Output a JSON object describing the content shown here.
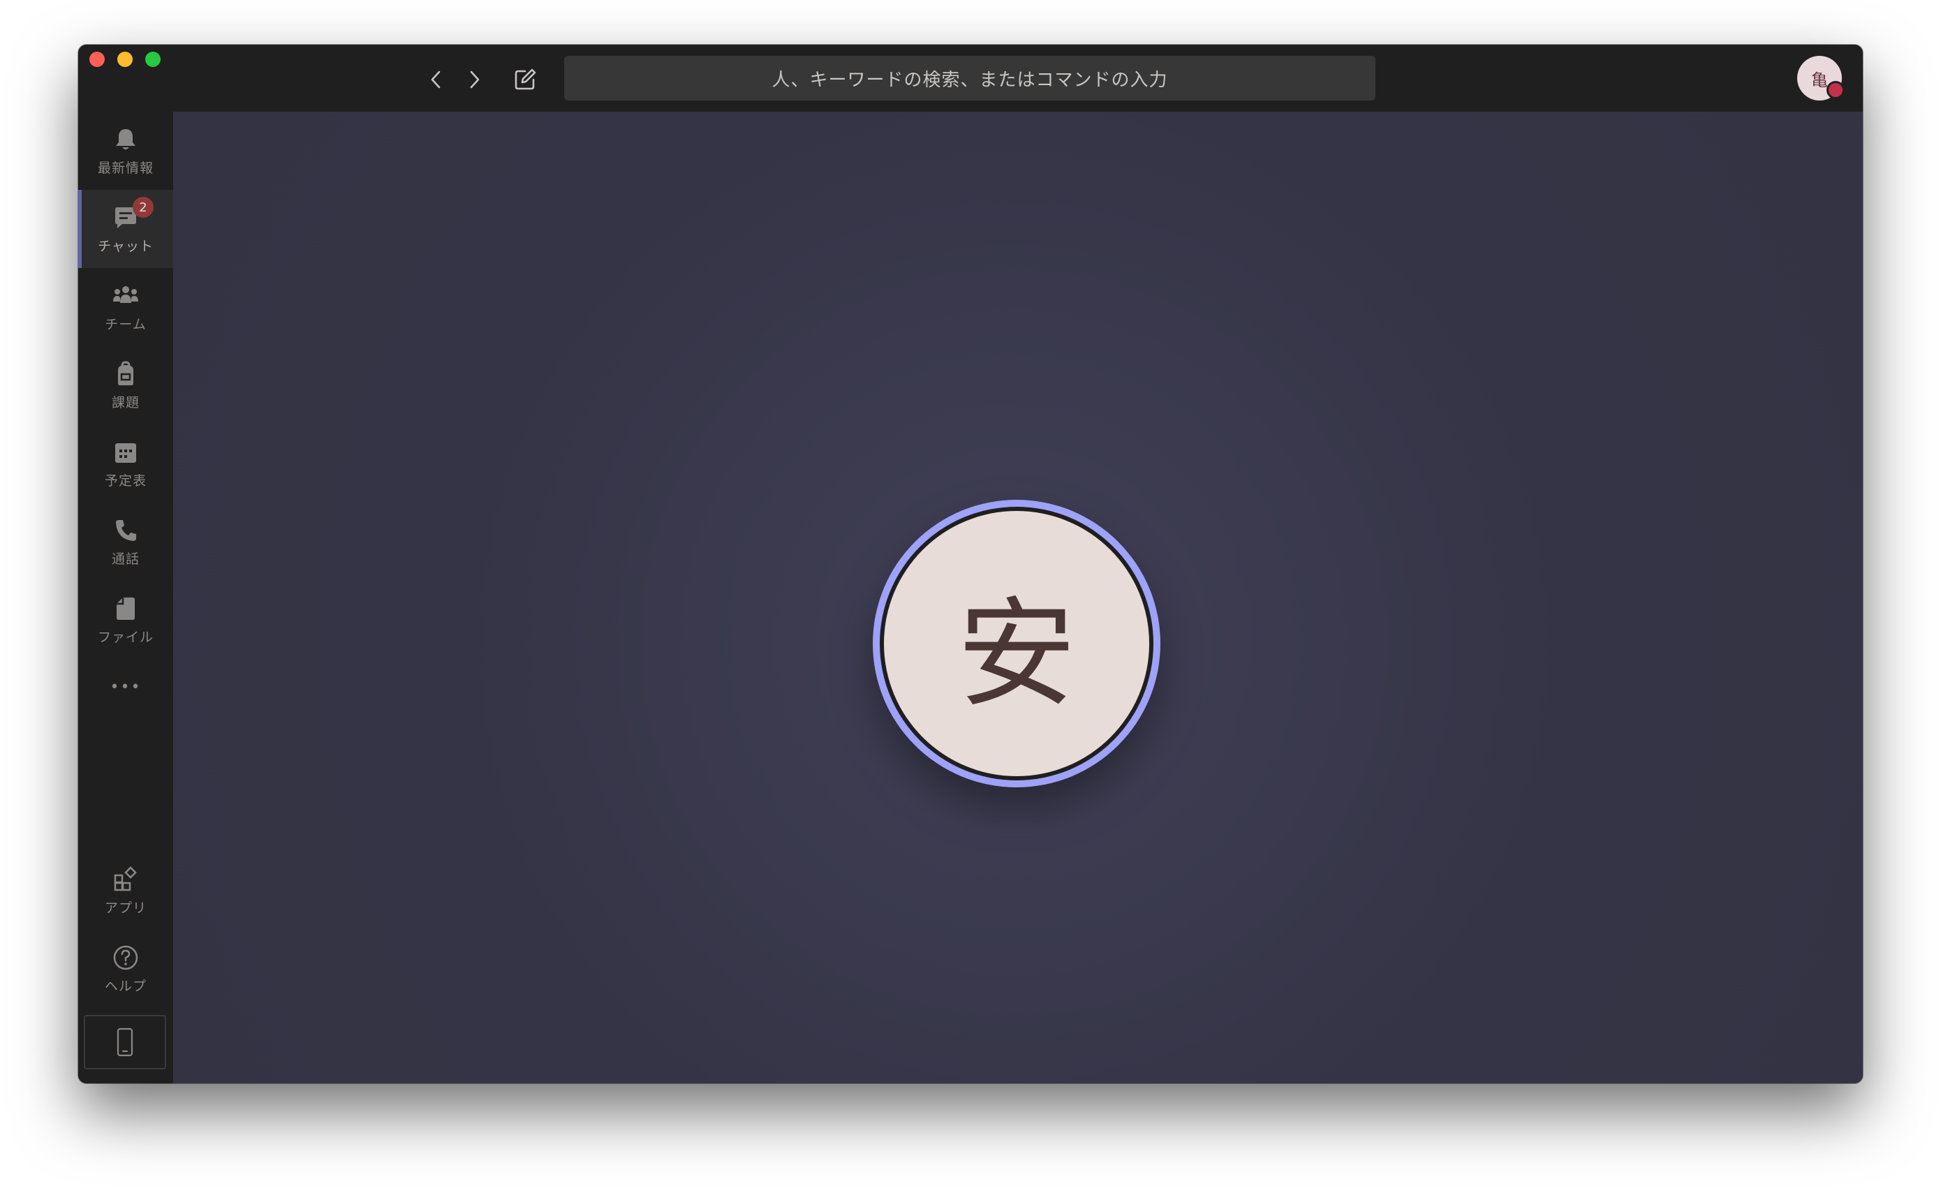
{
  "app": {
    "search": {
      "placeholder": "人、キーワードの検索、またはコマンドの入力"
    },
    "user_avatar": {
      "initial": "亀",
      "presence_color": "#c4314b"
    }
  },
  "rail": {
    "items": [
      {
        "id": "activity",
        "label": "最新情報",
        "icon": "bell-icon"
      },
      {
        "id": "chat",
        "label": "チャット",
        "icon": "chat-icon",
        "badge": "2",
        "active": true
      },
      {
        "id": "teams",
        "label": "チーム",
        "icon": "teams-icon"
      },
      {
        "id": "assignments",
        "label": "課題",
        "icon": "backpack-icon"
      },
      {
        "id": "calendar",
        "label": "予定表",
        "icon": "calendar-icon"
      },
      {
        "id": "calls",
        "label": "通話",
        "icon": "phone-icon"
      },
      {
        "id": "files",
        "label": "ファイル",
        "icon": "file-icon"
      }
    ],
    "more": "•••",
    "apps_label": "アプリ",
    "help_label": "ヘルプ"
  },
  "call": {
    "initial": "安",
    "ring_color": "#9ea2f8"
  },
  "colors": {
    "accent": "#6264a7",
    "badge": "#8f3a3a"
  }
}
